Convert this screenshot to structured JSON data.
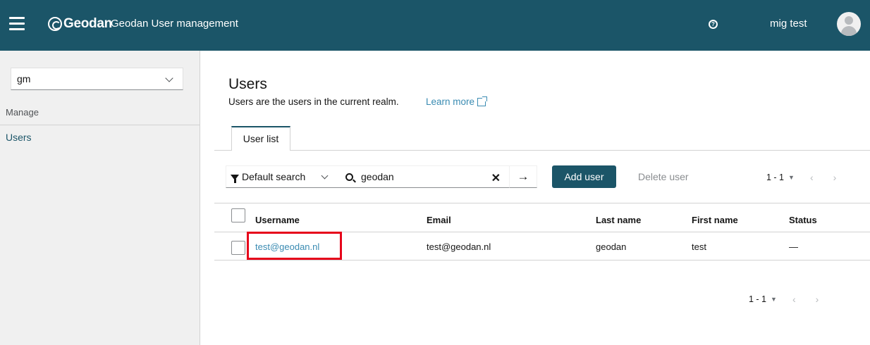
{
  "header": {
    "logo_text": "Geodan",
    "app_title": "Geodan User management",
    "user_name": "mig test",
    "help_symbol": "?"
  },
  "sidebar": {
    "realm": "gm",
    "section_label": "Manage",
    "items": [
      {
        "label": "Users"
      }
    ]
  },
  "main": {
    "title": "Users",
    "description": "Users are the users in the current realm.",
    "learn_more": "Learn more",
    "tabs": [
      {
        "label": "User list"
      }
    ],
    "toolbar": {
      "filter_label": "Default search",
      "search_value": "geodan",
      "add_user": "Add user",
      "delete_user": "Delete user"
    },
    "pagination": {
      "range": "1 - 1",
      "caret": "▼",
      "prev": "‹",
      "next": "›"
    },
    "table": {
      "columns": [
        "Username",
        "Email",
        "Last name",
        "First name",
        "Status"
      ],
      "rows": [
        {
          "username": "test@geodan.nl",
          "email": "test@geodan.nl",
          "last_name": "geodan",
          "first_name": "test",
          "status": "—"
        }
      ]
    }
  },
  "colors": {
    "brand": "#1b5568",
    "link": "#3a8bb2",
    "highlight": "#e6001a"
  },
  "icons": [
    "hamburger-icon",
    "help-icon",
    "avatar",
    "chevron-down-icon",
    "external-link-icon",
    "filter-icon",
    "search-icon",
    "close-icon",
    "arrow-right-icon"
  ]
}
